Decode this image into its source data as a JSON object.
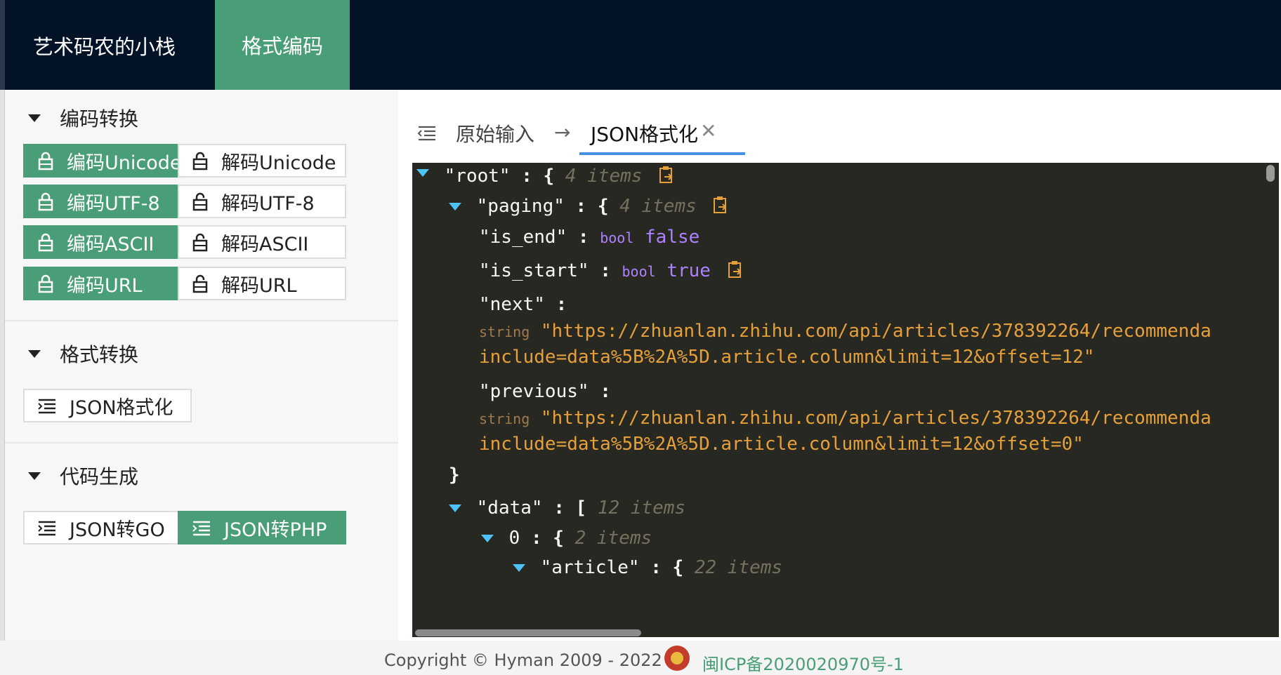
{
  "header": {
    "brand": "艺术码农的小栈",
    "nav_tab": "格式编码"
  },
  "sidebar": {
    "sections": [
      {
        "title": "编码转换",
        "buttons": [
          {
            "label": "编码Unicode",
            "style": "green",
            "icon": "lock-icon"
          },
          {
            "label": "解码Unicode",
            "style": "white",
            "icon": "unlock-icon"
          },
          {
            "label": "编码UTF-8",
            "style": "green",
            "icon": "lock-icon"
          },
          {
            "label": "解码UTF-8",
            "style": "white",
            "icon": "unlock-icon"
          },
          {
            "label": "编码ASCII",
            "style": "green",
            "icon": "lock-icon"
          },
          {
            "label": "解码ASCII",
            "style": "white",
            "icon": "unlock-icon"
          },
          {
            "label": "编码URL",
            "style": "green",
            "icon": "lock-icon"
          },
          {
            "label": "解码URL",
            "style": "white",
            "icon": "unlock-icon"
          }
        ]
      },
      {
        "title": "格式转换",
        "buttons": [
          {
            "label": "JSON格式化",
            "style": "white",
            "icon": "list-indent-icon"
          }
        ]
      },
      {
        "title": "代码生成",
        "buttons": [
          {
            "label": "JSON转GO",
            "style": "white",
            "icon": "list-indent-icon"
          },
          {
            "label": "JSON转PHP",
            "style": "green",
            "icon": "list-indent-icon"
          }
        ]
      }
    ]
  },
  "main": {
    "tabs": {
      "raw": "原始输入",
      "arrow": "→",
      "active": "JSON格式化",
      "close": "✕"
    },
    "editor": {
      "root_key": "\"root\"",
      "root_count": "4 items",
      "paging_key": "\"paging\"",
      "paging_count": "4 items",
      "is_end_key": "\"is_end\"",
      "is_end_type": "bool",
      "is_end_val": "false",
      "is_start_key": "\"is_start\"",
      "is_start_type": "bool",
      "is_start_val": "true",
      "next_key": "\"next\"",
      "next_type": "string",
      "next_val_1": "\"https://zhuanlan.zhihu.com/api/articles/378392264/recommenda",
      "next_val_2": "include=data%5B%2A%5D.article.column&limit=12&offset=12\"",
      "previous_key": "\"previous\"",
      "previous_type": "string",
      "previous_val_1": "\"https://zhuanlan.zhihu.com/api/articles/378392264/recommenda",
      "previous_val_2": "include=data%5B%2A%5D.article.column&limit=12&offset=0\"",
      "close_brace": "}",
      "data_key": "\"data\"",
      "data_count": "12 items",
      "item0_key": "0",
      "item0_count": "2 items",
      "article_key": "\"article\"",
      "article_count": "22 items"
    },
    "colors": {
      "key": "#f8f8f2",
      "string": "#e6a03a",
      "bool": "#ae81ff",
      "count": "#75715e",
      "toggle": "#4fc3f7"
    }
  },
  "footer": {
    "copyright": "Copyright © Hyman 2009 - 2022",
    "icp": "闽ICP备2020020970号-1"
  },
  "colors": {
    "header_bg": "#021327",
    "accent_green": "#4a9e77",
    "editor_bg": "#272822",
    "tab_underline": "#4a90e2"
  }
}
